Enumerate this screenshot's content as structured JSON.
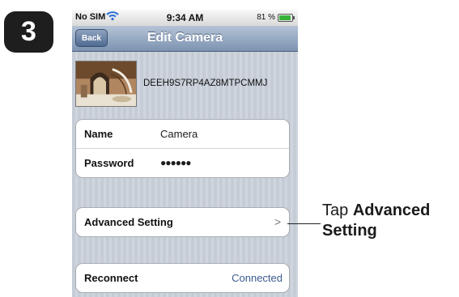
{
  "step": {
    "number": "3"
  },
  "status_bar": {
    "carrier": "No SIM",
    "time": "9:34 AM",
    "battery": "81 %",
    "battery_fraction": 0.81
  },
  "nav": {
    "back_label": "Back",
    "title": "Edit Camera"
  },
  "camera": {
    "id": "DEEH9S7RP4AZ8MTPCMMJ"
  },
  "fields": {
    "name_label": "Name",
    "name_value": "Camera",
    "password_label": "Password",
    "password_value": "●●●●●●"
  },
  "advanced": {
    "label": "Advanced Setting",
    "chevron": ">"
  },
  "reconnect": {
    "label": "Reconnect",
    "status": "Connected"
  },
  "callout": {
    "prefix": "Tap ",
    "bold": "Advanced Setting"
  },
  "colors": {
    "nav_bar": "#7c93b1",
    "status_link": "#3b5b8f",
    "badge": "#1e1e1e"
  }
}
